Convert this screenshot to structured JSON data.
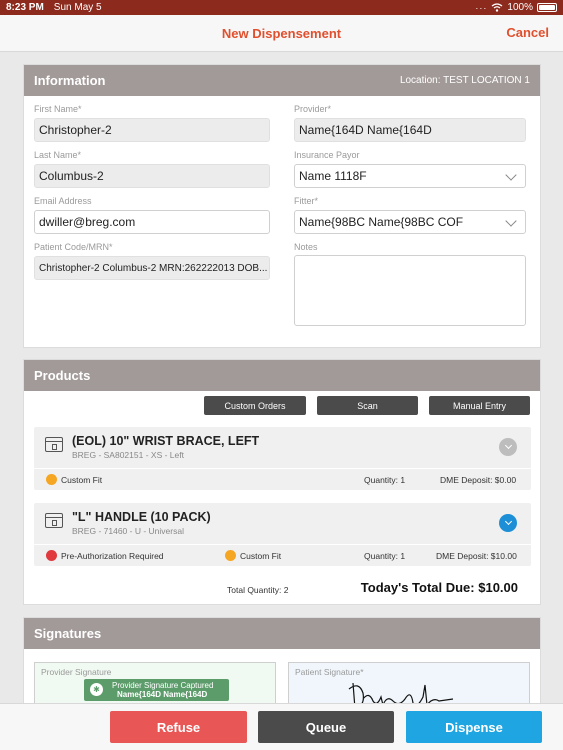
{
  "status_bar": {
    "time": "8:23 PM",
    "date": "Sun May 5",
    "wifi": "wifi-icon",
    "battery_text": "100%"
  },
  "nav": {
    "title": "New Dispensement",
    "cancel_label": "Cancel"
  },
  "information": {
    "title": "Information",
    "location": "Location: TEST LOCATION 1",
    "first_name": {
      "label": "First Name*",
      "value": "Christopher-2"
    },
    "last_name": {
      "label": "Last Name*",
      "value": "Columbus-2"
    },
    "email": {
      "label": "Email Address",
      "value": "dwiller@breg.com"
    },
    "patient_code": {
      "label": "Patient Code/MRN*",
      "value": "Christopher-2 Columbus-2 MRN:262222013 DOB..."
    },
    "provider": {
      "label": "Provider*",
      "value": "Name{164D Name{164D"
    },
    "insurance": {
      "label": "Insurance Payor",
      "value": "Name 1118F"
    },
    "fitter": {
      "label": "Fitter*",
      "value": "Name{98BC Name{98BC COF"
    },
    "notes": {
      "label": "Notes",
      "value": ""
    }
  },
  "products": {
    "title": "Products",
    "buttons": {
      "custom_orders": "Custom Orders",
      "scan": "Scan",
      "manual_entry": "Manual Entry"
    },
    "items": [
      {
        "name": "(EOL) 10\" WRIST BRACE, LEFT",
        "sub": "BREG - SA802151 - XS - Left",
        "tags": [
          "Custom Fit"
        ],
        "quantity": "Quantity: 1",
        "deposit": "DME Deposit: $0.00",
        "toggle_color": "#bdbdbd"
      },
      {
        "name": "\"L\" HANDLE (10 PACK)",
        "sub": "BREG - 71460 - U - Universal",
        "tags": [
          "Pre-Authorization Required",
          "Custom Fit"
        ],
        "quantity": "Quantity: 1",
        "deposit": "DME Deposit: $10.00",
        "toggle_color": "#1c8fd6"
      }
    ],
    "total_quantity": "Total Quantity: 2",
    "total_due": "Today's Total Due: $10.00"
  },
  "signatures": {
    "title": "Signatures",
    "provider_label": "Provider Signature",
    "captured_line1": "Provider Signature Captured",
    "captured_line2": "Name{164D Name{164D",
    "patient_label": "Patient Signature*"
  },
  "actions": {
    "refuse": "Refuse",
    "queue": "Queue",
    "dispense": "Dispense"
  },
  "colors": {
    "status_bar": "#8b2a1d",
    "accent": "#e0502e",
    "header": "#a29a98",
    "refuse": "#e85756",
    "queue": "#4b4b4b",
    "dispense": "#1ea5e2"
  }
}
